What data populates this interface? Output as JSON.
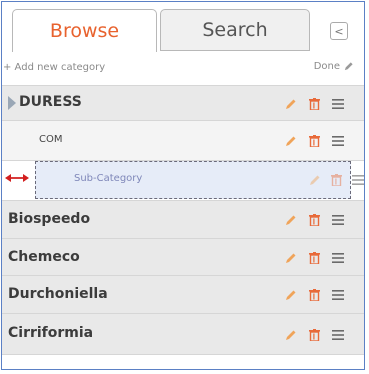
{
  "tabs": {
    "browse": "Browse",
    "search": "Search"
  },
  "collapse_button": "<",
  "toolbar": {
    "add_label": "+ Add new category",
    "done_label": "Done"
  },
  "categories": [
    {
      "label": "DURESS"
    },
    {
      "label": "COM"
    },
    {
      "label": "Biospeedo"
    },
    {
      "label": "Chemeco"
    },
    {
      "label": "Durchoniella"
    },
    {
      "label": "Cirriformia"
    }
  ],
  "drag_item": {
    "label": "Sub-Category"
  },
  "colors": {
    "accent": "#e8622e",
    "icon_orange": "#f0a45a",
    "drag_arrow": "#d31f1f",
    "frame": "#5b80c5"
  },
  "icons": [
    "edit-icon",
    "trash-icon",
    "drag-handle-icon",
    "caret-right-icon",
    "pencil-icon",
    "left-arrow-icon"
  ]
}
